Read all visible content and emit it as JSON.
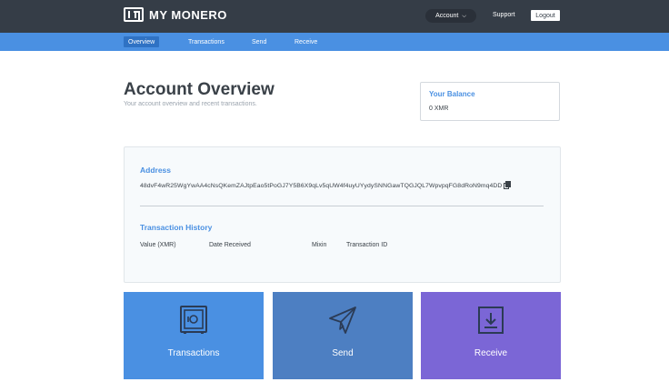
{
  "header": {
    "logo_text": "MY MONERO",
    "account_label": "Account",
    "support_label": "Support",
    "logout_label": "Logout"
  },
  "nav": {
    "items": [
      {
        "label": "Overview",
        "active": true
      },
      {
        "label": "Transactions",
        "active": false
      },
      {
        "label": "Send",
        "active": false
      },
      {
        "label": "Receive",
        "active": false
      }
    ]
  },
  "page": {
    "title": "Account Overview",
    "subtitle": "Your account overview and recent transactions."
  },
  "balance": {
    "title": "Your Balance",
    "value": "0 XMR"
  },
  "address": {
    "label": "Address",
    "value": "48dvF4wR25WgYwAA4cNsQKemZAJtpEao5tPoGJ7Y5B6X9qLv5qUW4f4uyUYydySNNGawTQGJQL7WpvpqFG8dRoN9mq4DD"
  },
  "history": {
    "label": "Transaction History",
    "columns": [
      "Value (XMR)",
      "Date Received",
      "Mixin",
      "Transaction ID"
    ]
  },
  "tiles": [
    {
      "label": "Transactions",
      "icon": "safe-icon"
    },
    {
      "label": "Send",
      "icon": "paper-plane-icon"
    },
    {
      "label": "Receive",
      "icon": "download-icon"
    }
  ],
  "colors": {
    "topbar": "#353d47",
    "accent_blue": "#4a90e2",
    "send_blue": "#4d7fc2",
    "receive_purple": "#7b66d6"
  }
}
